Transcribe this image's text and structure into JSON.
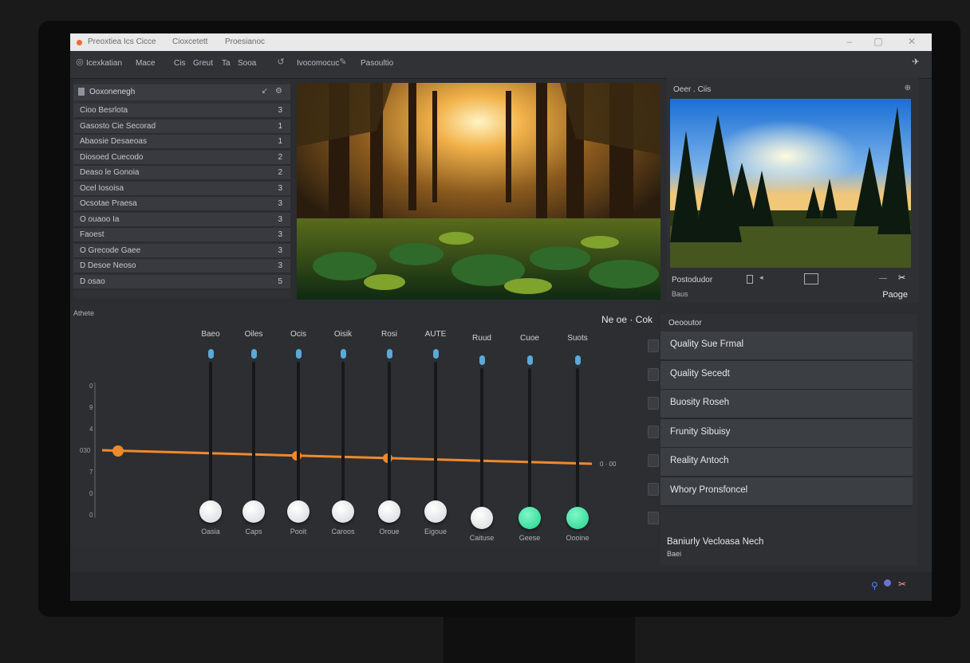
{
  "titlebar": {
    "title": "Preoxtiea Ics Cicce",
    "menu1": "Cioxcetett",
    "menu2": "Proesianoc"
  },
  "toolbar": {
    "items": [
      "Icexkatian",
      "Mace",
      "Cis",
      "Greut",
      "Ta",
      "Sooa",
      "Ivocomocuc",
      "Pasoultio"
    ]
  },
  "left_panel": {
    "header": "Ooxonenegh",
    "rows": [
      {
        "label": "Cioo Besrlota",
        "value": "3"
      },
      {
        "label": "Gasosto Cie Secorad",
        "value": "1"
      },
      {
        "label": "Abaosie Desaeoas",
        "value": "1"
      },
      {
        "label": "Diosoed Cuecodo",
        "value": "2"
      },
      {
        "label": "Deaso le Gonoia",
        "value": "2"
      },
      {
        "label": "Ocel Iosoisa",
        "value": "3"
      },
      {
        "label": "Ocsotae Praesa",
        "value": "3"
      },
      {
        "label": "O ouaoo Ia",
        "value": "3"
      },
      {
        "label": "Faoest",
        "value": "3"
      },
      {
        "label": "O Grecode Gaee",
        "value": "3"
      },
      {
        "label": "D Desoe Neoso",
        "value": "3"
      },
      {
        "label": "D osao",
        "value": "5"
      }
    ]
  },
  "preview_panel": {
    "title": "Oeer . Ciis",
    "caption": "Postodudor",
    "caption2": "Baus",
    "page_label": "Paoge"
  },
  "equalizer": {
    "section_label": "Athete",
    "top_right_label": "Ne oe · Cok",
    "axis_labels": [
      "0",
      "9",
      "4",
      "030",
      "7",
      "0",
      "0"
    ],
    "line_end_label": "0 · 00",
    "bands": [
      {
        "top": "Baeo",
        "bottom": "Oasia",
        "level": 0.0
      },
      {
        "top": "Oiles",
        "bottom": "Caps",
        "level": 0.0
      },
      {
        "top": "Ocis",
        "bottom": "Pooit",
        "level": 0.0
      },
      {
        "top": "Oisik",
        "bottom": "Caroos",
        "level": 0.0
      },
      {
        "top": "Rosi",
        "bottom": "Oroue",
        "level": 0.0
      },
      {
        "top": "AUTE",
        "bottom": "Eigoue",
        "level": 0.0
      },
      {
        "top": "Ruud",
        "bottom": "Caituse",
        "level": 0.0
      },
      {
        "top": "Cuoe",
        "bottom": "Geese",
        "level": 0.0
      },
      {
        "top": "Suots",
        "bottom": "Oooine",
        "level": 0.0
      }
    ]
  },
  "quality_panel": {
    "header": "Oeooutor",
    "items": [
      "Quality Sue Frmal",
      "Quality Secedt",
      "Buosity Roseh",
      "Frunity Sibuisy",
      "Reality Antoch",
      "Whory Pronsfoncel"
    ],
    "footer_line1": "Baniurly Vecloasa Nech",
    "footer_line2": "Baei"
  },
  "colors": {
    "accent_orange": "#f0892c",
    "knob_green": "#22d48c",
    "tick_blue": "#5aa9d8"
  }
}
